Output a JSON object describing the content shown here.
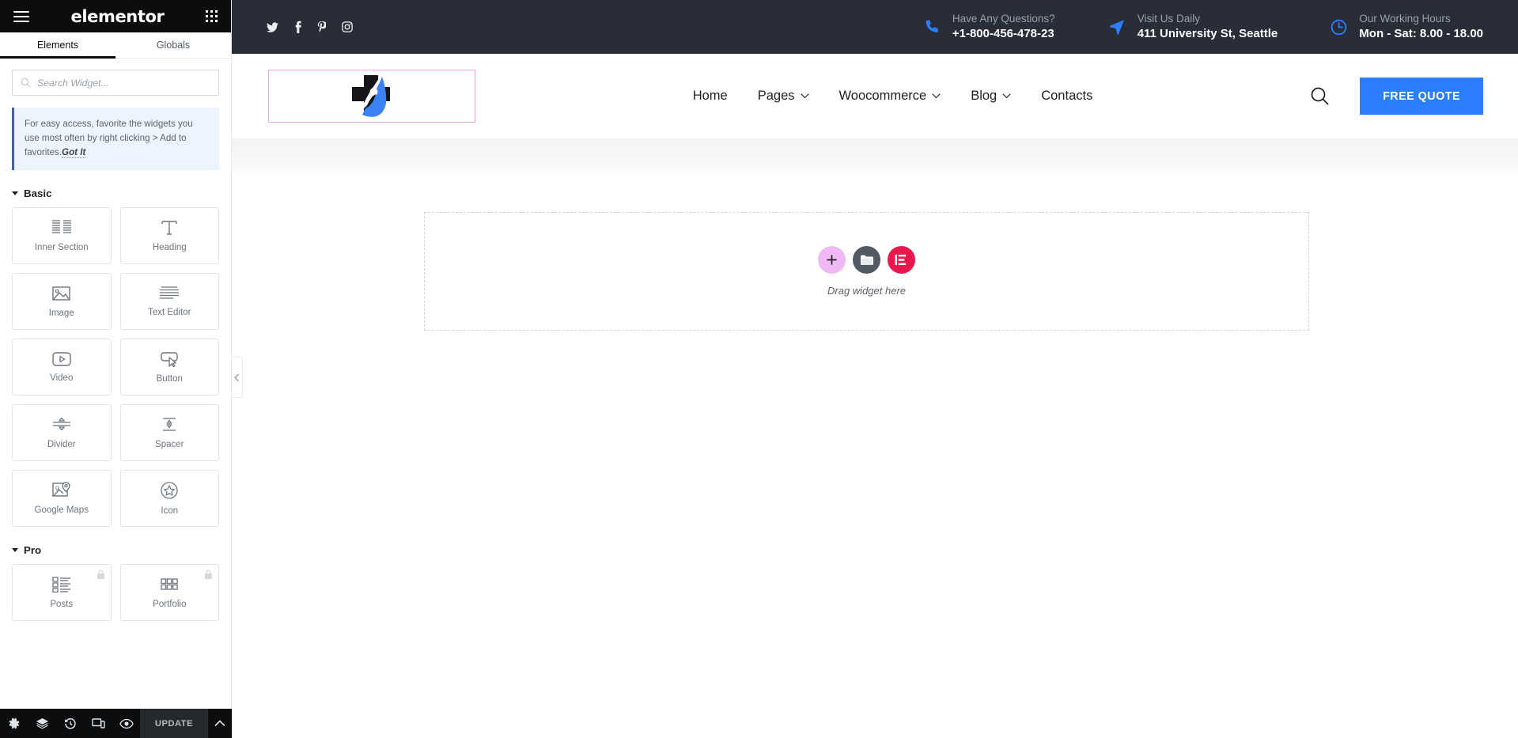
{
  "panel": {
    "brand": "elementor",
    "menu_icon": "hamburger-icon",
    "apps_icon": "apps-grid-icon",
    "tabs": [
      {
        "label": "Elements",
        "active": true
      },
      {
        "label": "Globals",
        "active": false
      }
    ],
    "search": {
      "placeholder": "Search Widget...",
      "value": "",
      "icon": "search-icon"
    },
    "notice": {
      "text": "For easy access, favorite the widgets you use most often by right clicking > Add to favorites.",
      "action": "Got It"
    },
    "categories": [
      {
        "label": "Basic",
        "expanded": true,
        "widgets": [
          {
            "label": "Inner Section",
            "icon": "columns-icon",
            "pro": false
          },
          {
            "label": "Heading",
            "icon": "heading-t-icon",
            "pro": false
          },
          {
            "label": "Image",
            "icon": "image-icon",
            "pro": false
          },
          {
            "label": "Text Editor",
            "icon": "text-lines-icon",
            "pro": false
          },
          {
            "label": "Video",
            "icon": "video-play-icon",
            "pro": false
          },
          {
            "label": "Button",
            "icon": "button-cursor-icon",
            "pro": false
          },
          {
            "label": "Divider",
            "icon": "divider-icon",
            "pro": false
          },
          {
            "label": "Spacer",
            "icon": "spacer-arrows-icon",
            "pro": false
          },
          {
            "label": "Google Maps",
            "icon": "map-pin-icon",
            "pro": false
          },
          {
            "label": "Icon",
            "icon": "star-circle-icon",
            "pro": false
          }
        ]
      },
      {
        "label": "Pro",
        "expanded": true,
        "widgets": [
          {
            "label": "Posts",
            "icon": "posts-list-icon",
            "pro": true
          },
          {
            "label": "Portfolio",
            "icon": "portfolio-grid-icon",
            "pro": true
          }
        ]
      }
    ],
    "footer": {
      "icons": [
        {
          "name": "settings-gear-icon"
        },
        {
          "name": "navigator-layers-icon"
        },
        {
          "name": "history-clock-icon"
        },
        {
          "name": "responsive-devices-icon"
        },
        {
          "name": "preview-eye-icon"
        }
      ],
      "update_label": "UPDATE",
      "caret_icon": "chevron-up-icon"
    },
    "collapse_icon": "chevron-left-icon"
  },
  "preview": {
    "topbar": {
      "socials": [
        {
          "name": "twitter-icon"
        },
        {
          "name": "facebook-icon"
        },
        {
          "name": "pinterest-icon"
        },
        {
          "name": "instagram-icon"
        }
      ],
      "info": [
        {
          "icon": "phone-icon",
          "top": "Have Any Questions?",
          "bottom": "+1-800-456-478-23"
        },
        {
          "icon": "location-arrow-icon",
          "top": "Visit Us Daily",
          "bottom": "411 University St, Seattle"
        },
        {
          "icon": "clock-icon",
          "top": "Our Working Hours",
          "bottom": "Mon - Sat: 8.00 - 18.00"
        }
      ]
    },
    "header": {
      "logo": {
        "name": "medical-cross-logo",
        "selected": true
      },
      "nav": [
        {
          "label": "Home",
          "dropdown": false
        },
        {
          "label": "Pages",
          "dropdown": true
        },
        {
          "label": "Woocommerce",
          "dropdown": true
        },
        {
          "label": "Blog",
          "dropdown": true
        },
        {
          "label": "Contacts",
          "dropdown": false
        }
      ],
      "search_icon": "search-icon",
      "cta_label": "FREE QUOTE"
    },
    "dropzone": {
      "add_icon": "plus-icon",
      "folder_icon": "folder-icon",
      "ai_icon": "elementor-ai-icon",
      "text": "Drag widget here"
    }
  },
  "colors": {
    "accent_blue": "#2b7fff",
    "topbar_dark": "#282d38",
    "panel_dark": "#0c0d0e",
    "elementor_pink": "#e8174c",
    "selection_pink": "#eba8e5",
    "notice_blue": "#3e5bd6"
  }
}
